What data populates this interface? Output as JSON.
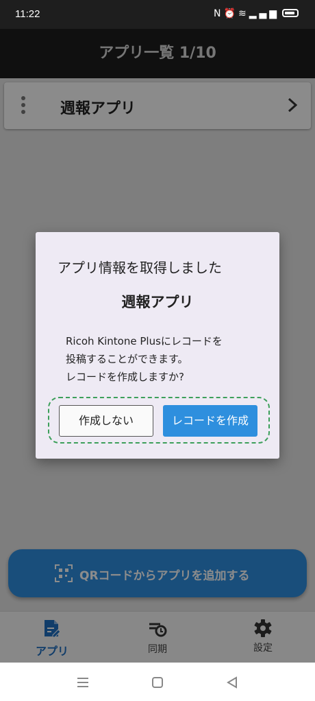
{
  "status_bar": {
    "time": "11:22"
  },
  "header": {
    "title": "アプリ一覧 1/10"
  },
  "app_list": {
    "items": [
      {
        "label": "週報アプリ"
      }
    ]
  },
  "fab": {
    "label": "QRコードからアプリを追加する"
  },
  "bottom_nav": {
    "items": [
      {
        "label": "アプリ",
        "icon": "document-edit-icon",
        "active": true
      },
      {
        "label": "同期",
        "icon": "sync-clock-icon",
        "active": false
      },
      {
        "label": "設定",
        "icon": "gear-icon",
        "active": false
      }
    ]
  },
  "dialog": {
    "title": "アプリ情報を取得しました",
    "app_name": "週報アプリ",
    "message_lines": [
      "Ricoh Kintone Plusにレコードを",
      "投稿することができます。",
      "レコードを作成しますか?"
    ],
    "cancel_label": "作成しない",
    "confirm_label": "レコードを作成"
  },
  "colors": {
    "accent": "#2e8fde",
    "highlight_border": "#3c9f5a",
    "app_bar": "#1e1e1e"
  }
}
